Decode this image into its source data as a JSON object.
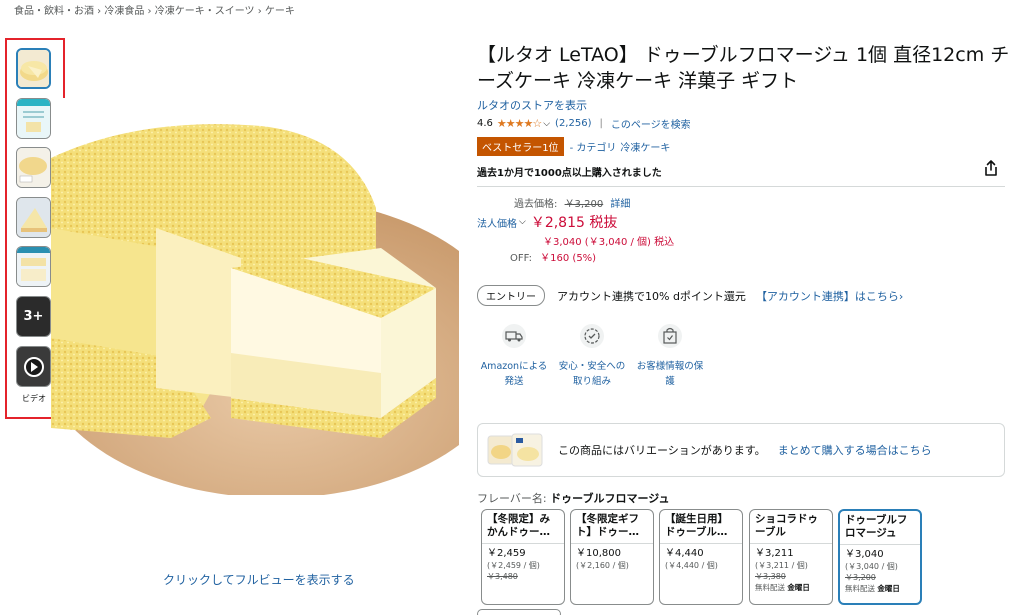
{
  "breadcrumb": "食品・飲料・お酒 › 冷凍食品 › 冷凍ケーキ・スイーツ › ケーキ",
  "gallery": {
    "more_label": "3+",
    "video_label": "ビデオ",
    "fullview_link": "クリックしてフルビューを表示する"
  },
  "product": {
    "title": "【ルタオ LeTAO】 ドゥーブルフロマージュ 1個 直径12cm チーズケーキ 冷凍ケーキ 洋菓子 ギフト",
    "store_link": "ルタオのストアを表示",
    "rating_value": "4.6",
    "stars": "★★★★☆",
    "rating_count": "(2,256)",
    "search_page": "このページを検索",
    "bestseller_badge": "ベストセラー1位",
    "category_prefix": "- カテゴリ",
    "category_link": "冷凍ケーキ",
    "bought_text": "過去1か月で1000点以上購入されました"
  },
  "price": {
    "past_label": "過去価格:",
    "past_value": "￥3,200",
    "detail_link": "詳細",
    "corp_label": "法人価格",
    "price_ex_tax": "￥2,815 税抜",
    "price_incl": "￥3,040 (￥3,040 / 個) 税込",
    "off_label": "OFF:",
    "off_value": "￥160 (5%)"
  },
  "points": {
    "entry_label": "エントリー",
    "text": "アカウント連携で10% dポイント還元",
    "link": "【アカウント連携】はこちら›"
  },
  "features": [
    {
      "icon": "truck-icon",
      "label": "Amazonによる発送"
    },
    {
      "icon": "shield-icon",
      "label": "安心・安全への取り組み"
    },
    {
      "icon": "bag-lock-icon",
      "label": "お客様情報の保護"
    }
  ],
  "variation": {
    "text": "この商品にはバリエーションがあります。",
    "link": "まとめて購入する場合はこちら"
  },
  "flavor": {
    "label": "フレーバー名:",
    "selected": "ドゥーブルフロマージュ"
  },
  "options": [
    {
      "name": "【冬限定】みかんドゥー…",
      "price": "￥2,459",
      "unit": "(￥2,459 / 個)",
      "list": "￥3,480",
      "ship_free": "",
      "ship_day": ""
    },
    {
      "name": "【冬限定ギフト】ドゥー…",
      "price": "￥10,800",
      "unit": "(￥2,160 / 個)",
      "list": "",
      "ship_free": "",
      "ship_day": ""
    },
    {
      "name": "【誕生日用】ドゥーブル…",
      "price": "￥4,440",
      "unit": "(￥4,440 / 個)",
      "list": "",
      "ship_free": "",
      "ship_day": ""
    },
    {
      "name": "ショコラドゥーブル",
      "price": "￥3,211",
      "unit": "(￥3,211 / 個)",
      "list": "￥3,380",
      "ship_free": "無料配送",
      "ship_day": "金曜日"
    },
    {
      "name": "ドゥーブルフロマージュ",
      "price": "￥3,040",
      "unit": "(￥3,040 / 個)",
      "list": "￥3,200",
      "ship_free": "無料配送",
      "ship_day": "金曜日"
    }
  ],
  "colors": {
    "accent_link": "#2162a1",
    "price_red": "#cc0c39",
    "bestseller": "#c45500",
    "highlight_box": "#e4232b",
    "selected_border": "#2a7fb8"
  }
}
